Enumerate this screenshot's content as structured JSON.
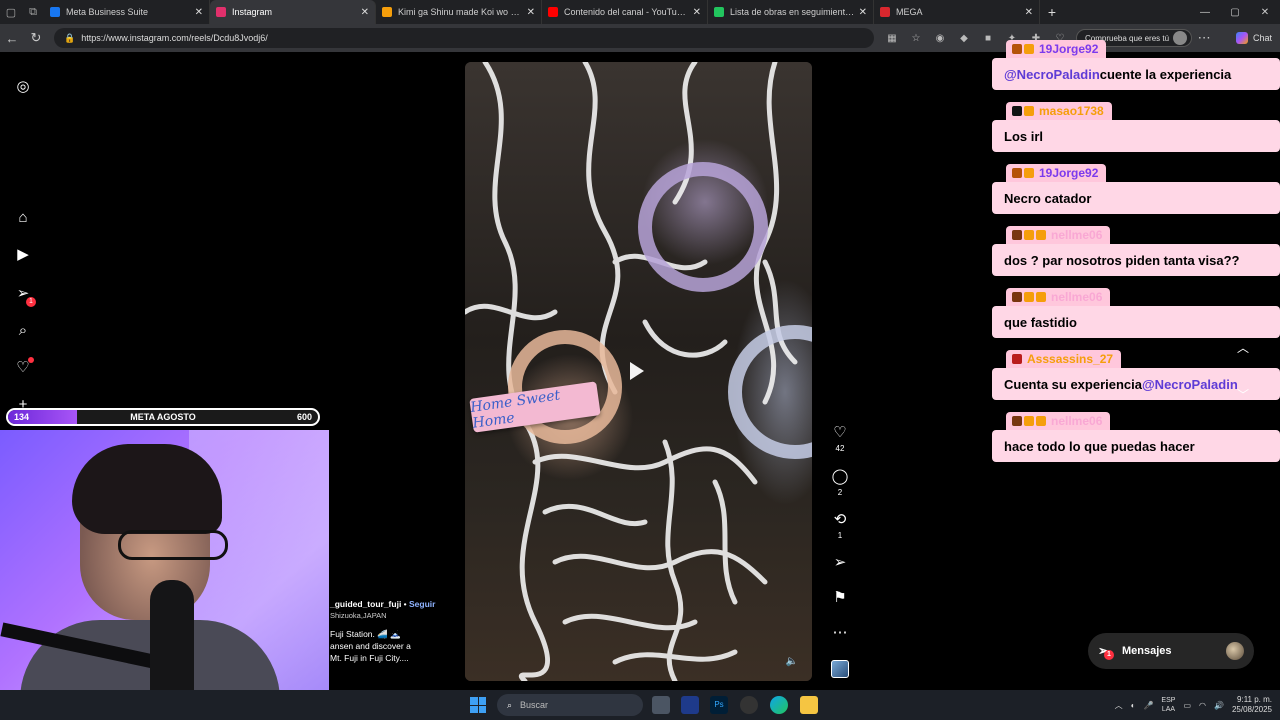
{
  "browser": {
    "tabs": [
      {
        "label": "Meta Business Suite",
        "fav_color": "#1877f2",
        "active": false
      },
      {
        "label": "Instagram",
        "fav_color": "#e1306c",
        "active": true
      },
      {
        "label": "Kimi ga Shinu made Koi wo Shitai",
        "fav_color": "#f59e0b",
        "active": false
      },
      {
        "label": "Contenido del canal - YouTube Studio",
        "fav_color": "#ff0000",
        "active": false
      },
      {
        "label": "Lista de obras en seguimiento - H",
        "fav_color": "#22c55e",
        "active": false
      },
      {
        "label": "MEGA",
        "fav_color": "#d9272e",
        "active": false
      }
    ],
    "url": "https://www.instagram.com/reels/Dcdu8Jvodj6/",
    "profile_pill": "Comprueba que eres tú",
    "chat_label": "Chat"
  },
  "stream": {
    "meta": {
      "current": "134",
      "label": "META AGOSTO",
      "target": "600",
      "progress_fraction": 0.223
    }
  },
  "reel": {
    "banner_text": "Home Sweet Home",
    "likes": "42",
    "comments": "2",
    "reposts": "1",
    "caption": {
      "user": "_guided_tour_fuji",
      "separator": " • ",
      "follow": "Seguir",
      "location": "Shizuoka,JAPAN",
      "line1": "Fuji Station. 🚄 🗻",
      "line2": "ansen and discover a",
      "line3": "Mt. Fuji in Fuji City...."
    }
  },
  "chat": {
    "messages": [
      {
        "user": "19Jorge92",
        "user_color": "#7c3aed",
        "text_pre": "",
        "mention": "@NecroPaladin",
        "text_post": " cuente la experiencia",
        "badges": [
          "#b45309",
          "#f59e0b"
        ]
      },
      {
        "user": "masao1738",
        "user_color": "#f59e0b",
        "text_pre": "Los irl",
        "mention": "",
        "text_post": "",
        "badges": [
          "#111111",
          "#f59e0b"
        ]
      },
      {
        "user": "19Jorge92",
        "user_color": "#7c3aed",
        "text_pre": "Necro catador",
        "mention": "",
        "text_post": "",
        "badges": [
          "#b45309",
          "#f59e0b"
        ]
      },
      {
        "user": "nellme06",
        "user_color": "#f9a8d4",
        "text_pre": "dos ? par nosotros piden tanta visa??",
        "mention": "",
        "text_post": "",
        "badges": [
          "#78350f",
          "#f59e0b",
          "#f59e0b"
        ]
      },
      {
        "user": "nellme06",
        "user_color": "#f9a8d4",
        "text_pre": "que fastidio",
        "mention": "",
        "text_post": "",
        "badges": [
          "#78350f",
          "#f59e0b",
          "#f59e0b"
        ]
      },
      {
        "user": "Asssassins_27",
        "user_color": "#f59e0b",
        "text_pre": "Cuenta su experiencia ",
        "mention": "@NecroPaladin",
        "text_post": "",
        "badges": [
          "#b91c1c"
        ]
      },
      {
        "user": "nellme06",
        "user_color": "#f9a8d4",
        "text_pre": "hace todo lo que puedas hacer",
        "mention": "",
        "text_post": "",
        "badges": [
          "#78350f",
          "#f59e0b",
          "#f59e0b"
        ]
      }
    ]
  },
  "messages_pill": {
    "label": "Mensajes",
    "badge": "1"
  },
  "sidebar": {
    "notif_badge": "1"
  },
  "taskbar": {
    "search_placeholder": "Buscar",
    "lang_top": "ESP",
    "lang_bottom": "LAA",
    "time": "9:11 p. m.",
    "date": "25/08/2025"
  }
}
